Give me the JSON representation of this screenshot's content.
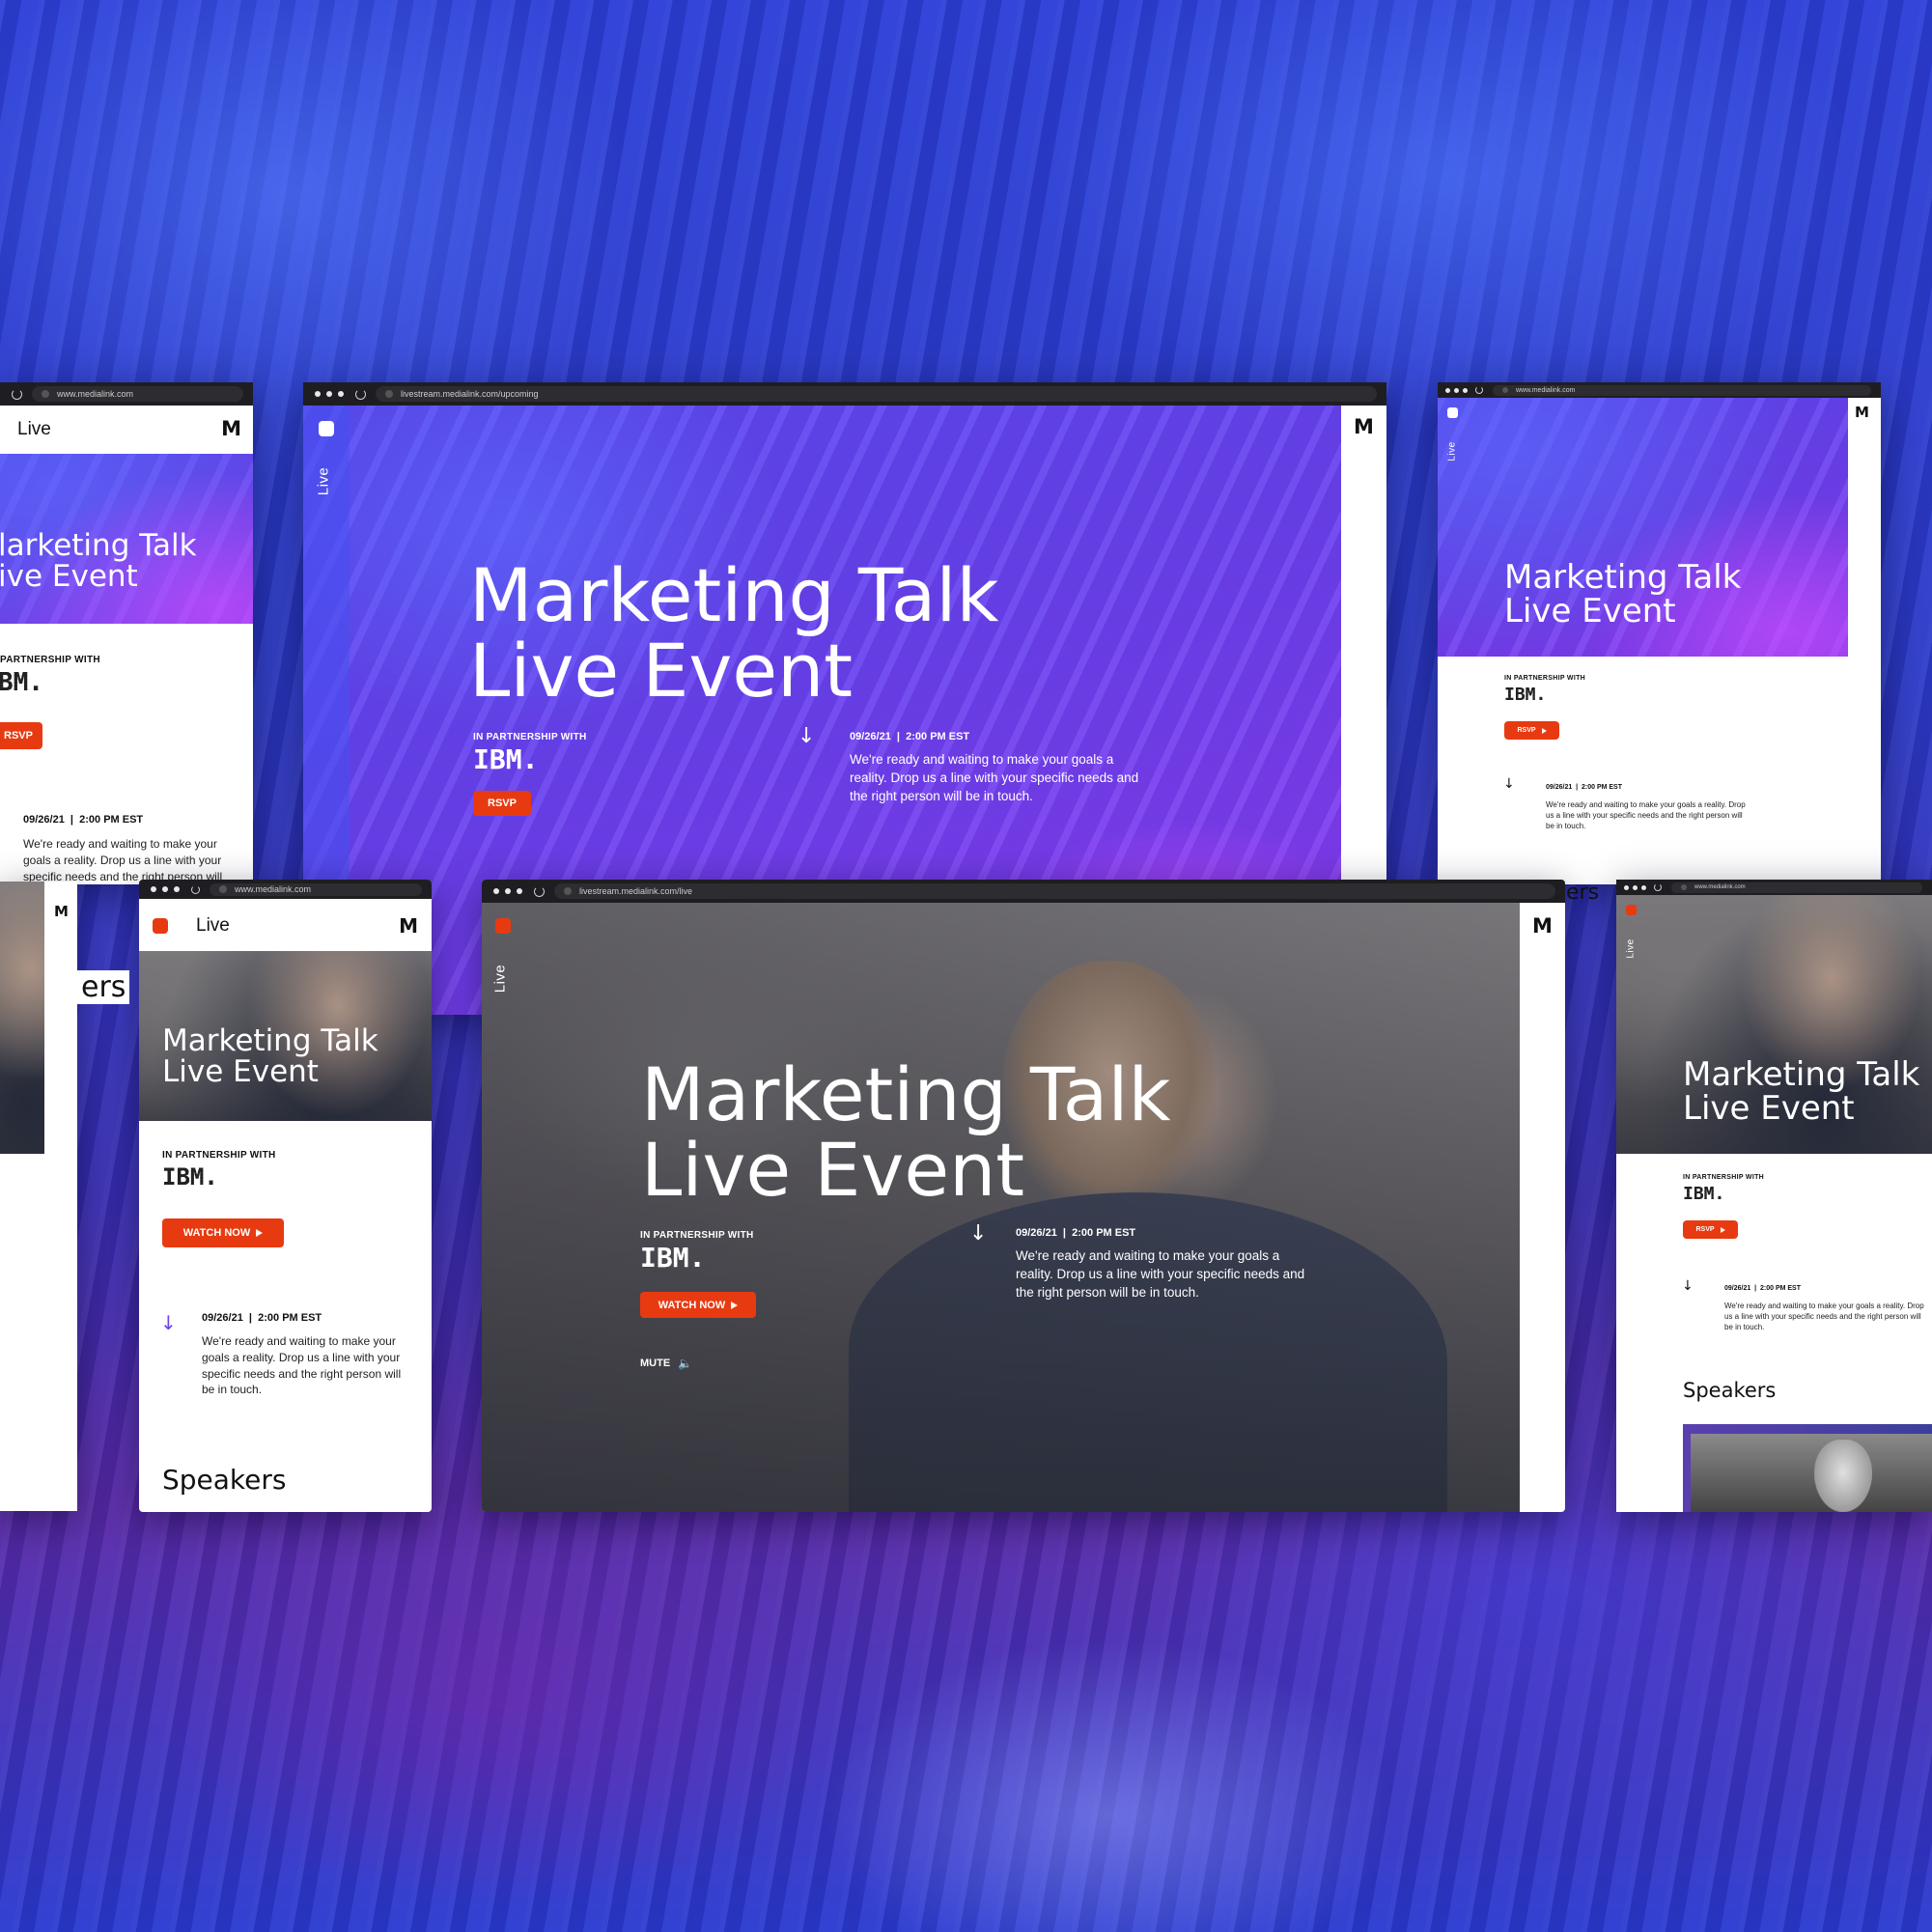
{
  "brand": {
    "logo_letter": "M",
    "accent": "#e83a10",
    "purple": "#6a45ef"
  },
  "common": {
    "live_label": "Live",
    "title_line1": "Marketing Talk",
    "title_line2": "Live Event",
    "partnership": "IN PARTNERSHIP WITH",
    "partner_logo": "IBM.",
    "rsvp": "RSVP",
    "watch_now": "WATCH NOW",
    "date": "09/26/21  |  2:00 PM EST",
    "description": "We're ready and waiting to make your goals a reality. Drop us a line with your specific needs and the right person will be in touch.",
    "speakers": "Speakers",
    "mute": "MUTE"
  },
  "windows": {
    "left_top": {
      "url": "www.medialink.com",
      "title_line1": "larketing Talk",
      "title_line2": "ive Event",
      "partnership": "PARTNERSHIP WITH",
      "partner_logo": "BM."
    },
    "main_upcoming": {
      "url": "livestream.medialink.com/upcoming"
    },
    "right_top": {
      "url": "www.medialink.com"
    },
    "left_bottom_peek": {
      "speakers_partial": "ers"
    },
    "mobile_watch": {
      "url": "www.medialink.com"
    },
    "main_live": {
      "url": "livestream.medialink.com/live"
    },
    "right_bottom": {
      "url": "www.medialink.com",
      "peek_text": "ers"
    }
  }
}
